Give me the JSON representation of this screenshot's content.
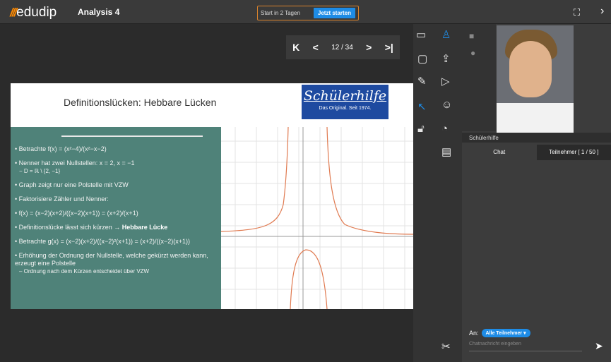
{
  "app": {
    "logo_mark": "///",
    "logo_text": "edudip",
    "title": "Analysis 4"
  },
  "trial": {
    "text": "Start in 2 Tagen",
    "button": "Jetzt starten"
  },
  "toolbar": {
    "fullscreen_icon": "⛶",
    "next_icon": "›"
  },
  "pager": {
    "first": "K",
    "prev": "<",
    "page": "12 / 34",
    "next": ">",
    "last": ">|"
  },
  "slide": {
    "title": "Definitionslücken: Hebbare Lücken",
    "brand_name": "Schülerhilfe",
    "brand_sub": "Das Original. Seit 1974.",
    "bullets": [
      "Betrachte f(x) = (x²−4)/(x²−x−2)",
      "Nenner hat zwei Nullstellen: x = 2, x = −1",
      "Graph zeigt nur eine Polstelle mit VZW",
      "Faktorisiere Zähler und Nenner:",
      "f(x) = (x−2)(x+2)/((x−2)(x+1)) = (x+2)/(x+1)",
      "Definitionslücke lässt sich kürzen →",
      "Betrachte g(x) = (x−2)(x+2)/((x−2)²(x+1)) = (x+2)/((x−2)(x+1))",
      "Erhöhung der Ordnung der Nullstelle, welche gekürzt werden kann, erzeugt eine Polstelle"
    ],
    "sub_domain": "− D = ℝ \\ {2, −1}",
    "bold_part": "Hebbare Lücke",
    "sub_last": "– Ordnung nach dem Kürzen entscheidet über VZW"
  },
  "video": {
    "label": "Schülerhilfe"
  },
  "chat": {
    "tab_chat": "Chat",
    "tab_participants": "Teilnehmer [ 1 / 50 ]",
    "to_label": "An:",
    "recipient": "Alle Teilnehmer",
    "placeholder": "Chatnachricht eingeben",
    "send_icon": "➤"
  },
  "colors": {
    "accent": "#1e8ce6",
    "trial_border": "#d9822b",
    "board": "#4f8279",
    "brand": "#1e4aa0",
    "curve": "#e07a50"
  }
}
